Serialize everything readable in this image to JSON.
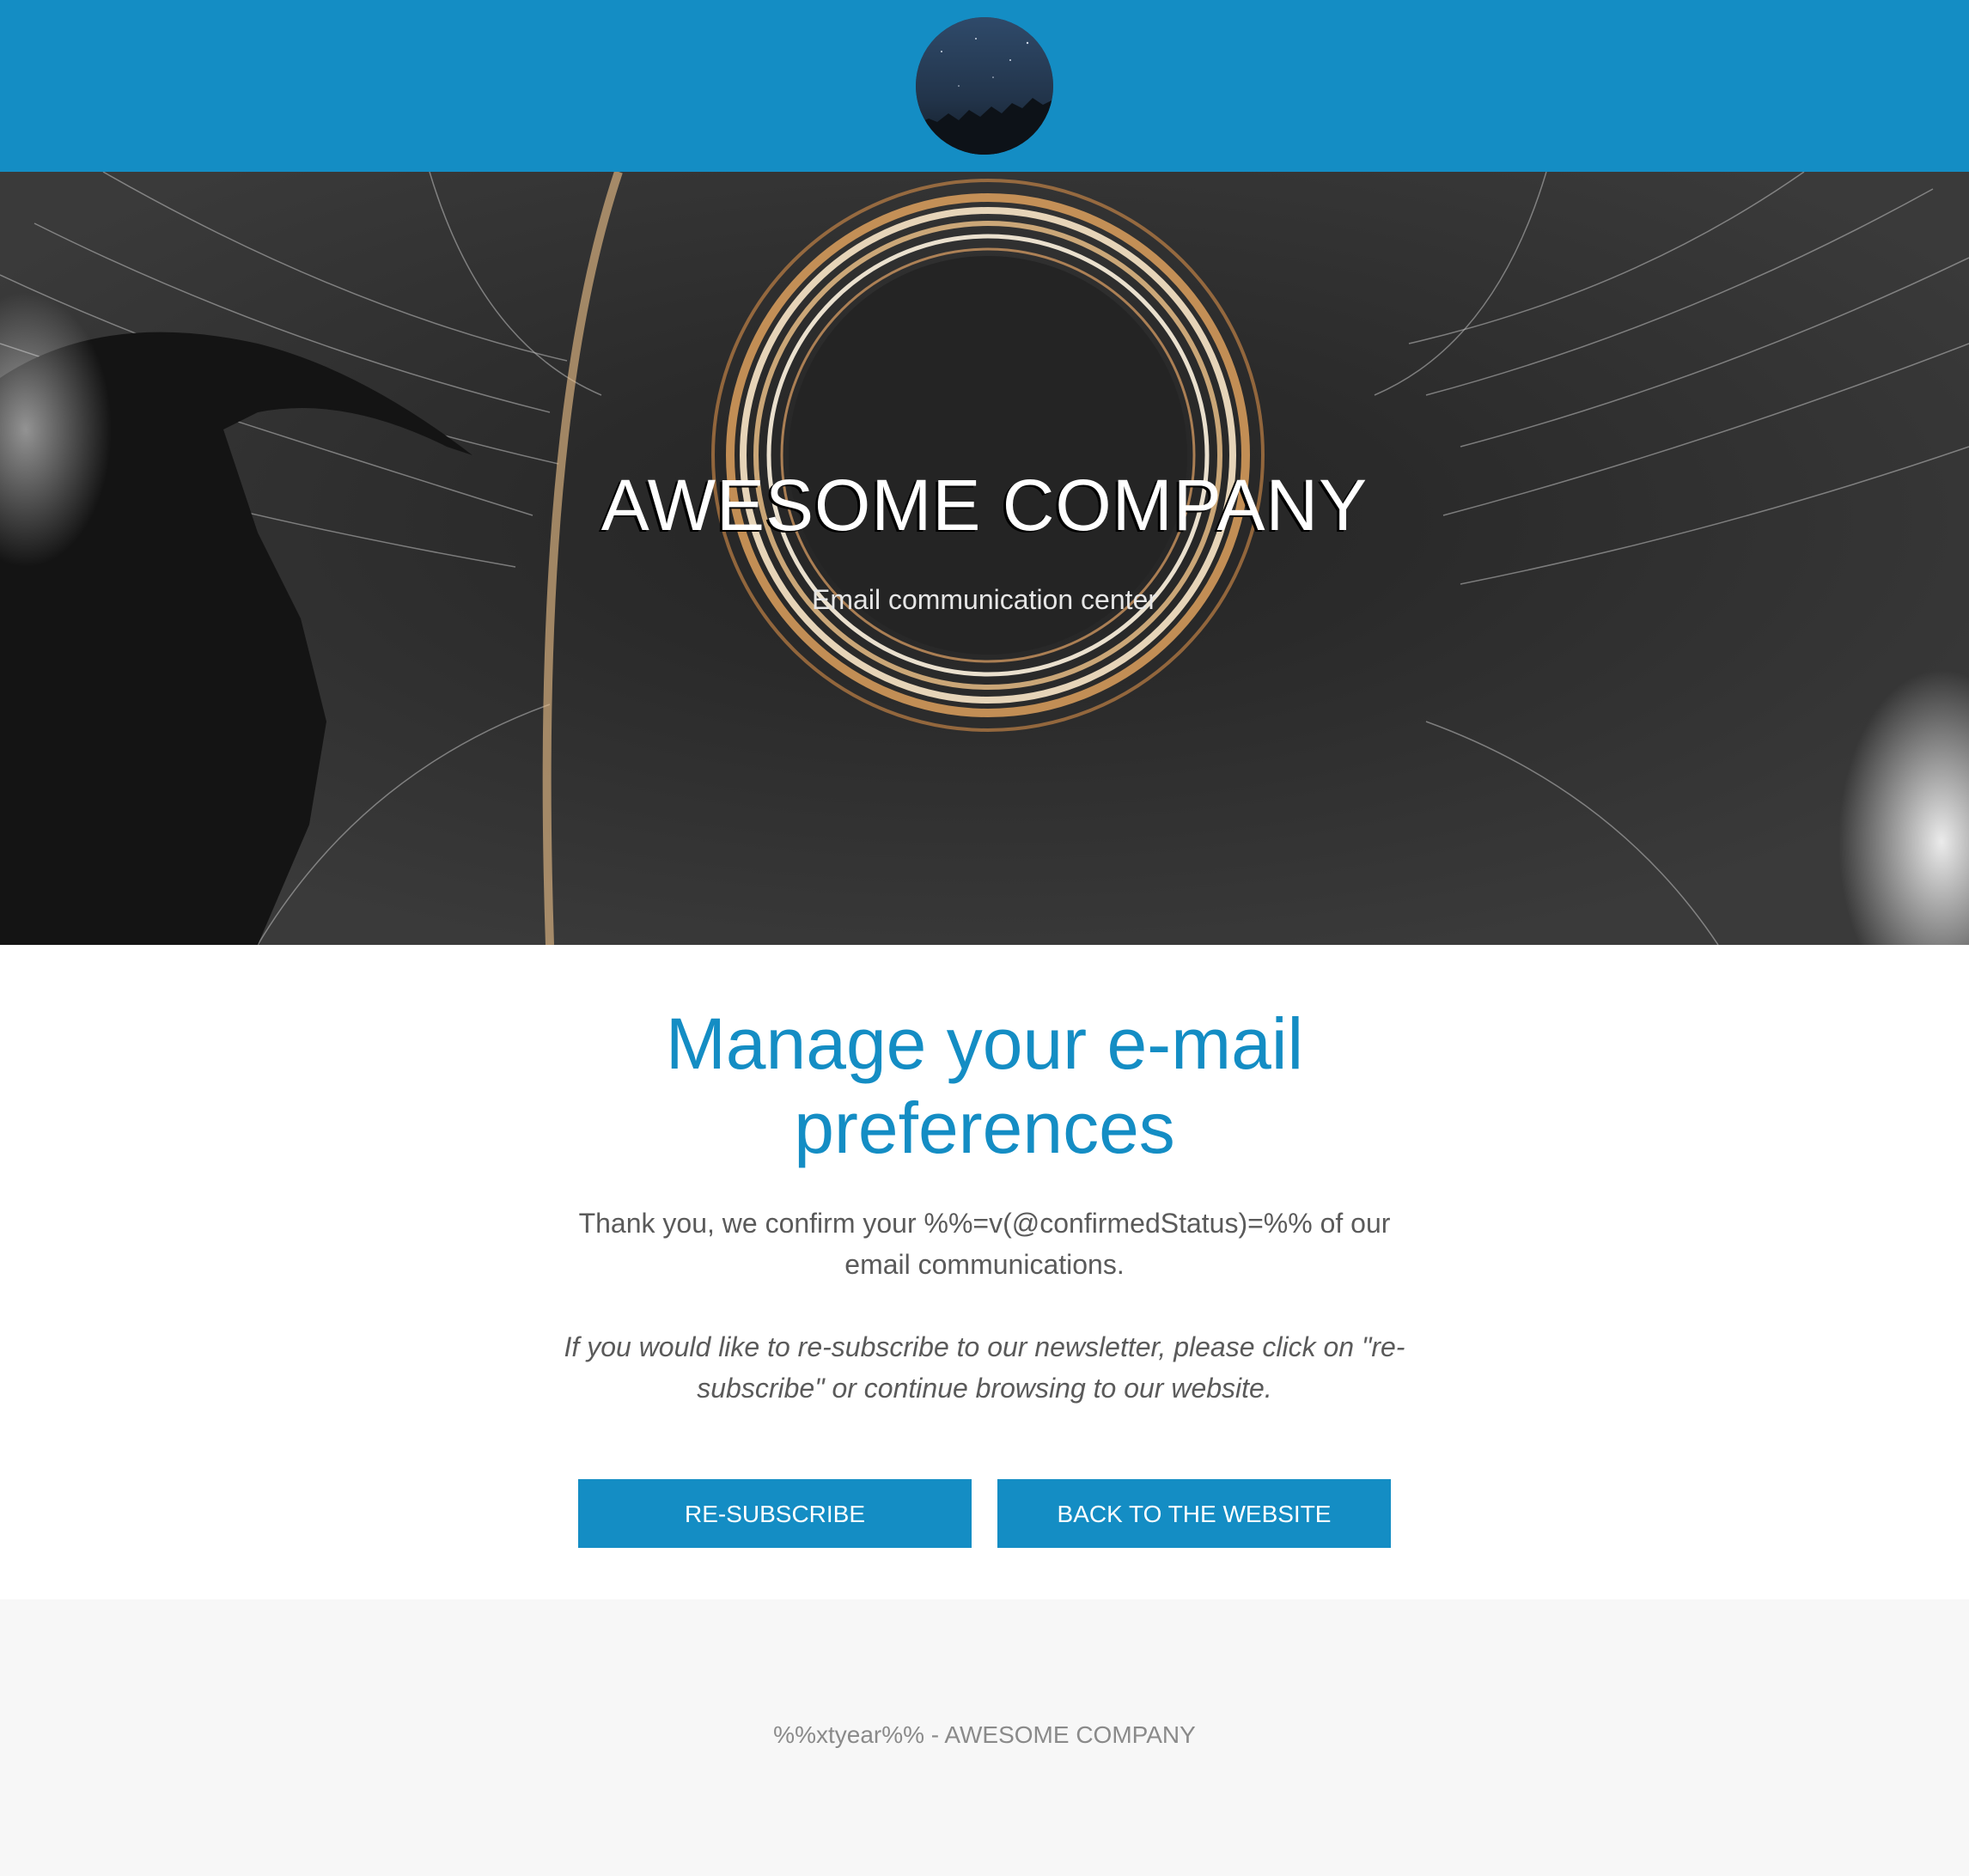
{
  "header": {
    "logo_icon": "night-sky-avatar-icon",
    "background_color": "#148dc4"
  },
  "hero": {
    "title": "AWESOME COMPANY",
    "subtitle": "Email communication center",
    "image": "light-painting-sparks-circle-image"
  },
  "main": {
    "heading": "Manage your e-mail preferences",
    "confirmation_text": "Thank you, we confirm your %%=v(@confirmedStatus)=%% of our email communications.",
    "resubscribe_text": "If you would like to re-subscribe to our newsletter, please click on \"re-subscribe\" or continue browsing to our website.",
    "accent_color": "#148dc4"
  },
  "buttons": {
    "resubscribe_label": "RE-SUBSCRIBE",
    "back_label": "BACK TO THE WEBSITE"
  },
  "footer": {
    "text": "%%xtyear%% - AWESOME COMPANY"
  }
}
